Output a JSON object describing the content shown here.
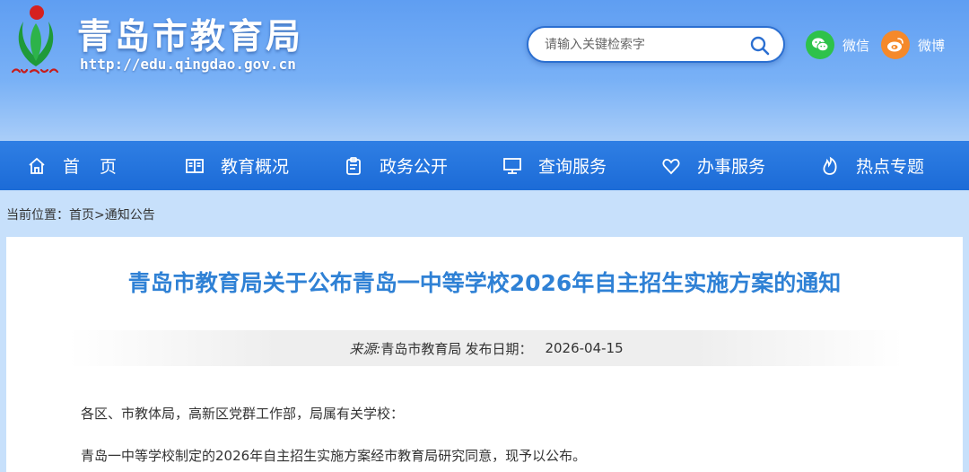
{
  "header": {
    "logo_title": "青岛市教育局",
    "url": "http://edu.qingdao.gov.cn",
    "search_placeholder": "请输入关键检索字",
    "social": [
      {
        "label": "微信",
        "icon": "wechat-icon",
        "color": "#2ec24a"
      },
      {
        "label": "微博",
        "icon": "weibo-icon",
        "color": "#f5892a"
      }
    ]
  },
  "nav": {
    "items": [
      {
        "label": "首页",
        "icon": "home-icon"
      },
      {
        "label": "教育概况",
        "icon": "book-icon"
      },
      {
        "label": "政务公开",
        "icon": "clipboard-icon"
      },
      {
        "label": "查询服务",
        "icon": "monitor-icon"
      },
      {
        "label": "办事服务",
        "icon": "heart-icon"
      },
      {
        "label": "热点专题",
        "icon": "flame-icon"
      }
    ]
  },
  "breadcrumb": {
    "prefix": "当前位置：",
    "home": "首页",
    "separator": ">",
    "current": "通知公告"
  },
  "article": {
    "title": "青岛市教育局关于公布青岛一中等学校2026年自主招生实施方案的通知",
    "source_label": "来源:",
    "source": "青岛市教育局",
    "date_label": "发布日期：",
    "date": "2026-04-15",
    "paragraphs": [
      "各区、市教体局，高新区党群工作部，局属有关学校：",
      "青岛一中等学校制定的2026年自主招生实施方案经市教育局研究同意，现予以公布。"
    ]
  },
  "colors": {
    "nav_bg": "#1c6bd7",
    "title_blue": "#2f81d5",
    "header_gradient_top": "#5f9ef2"
  }
}
